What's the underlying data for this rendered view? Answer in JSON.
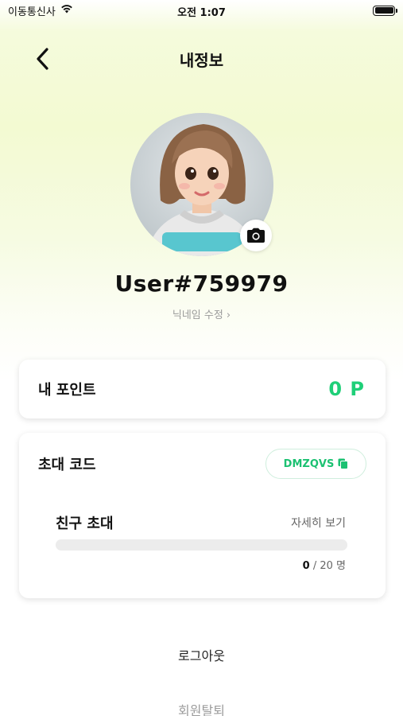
{
  "status_bar": {
    "carrier": "이동통신사",
    "time": "오전 1:07",
    "wifi_icon": "wifi-icon",
    "battery_icon": "battery-icon"
  },
  "nav": {
    "title": "내정보",
    "back_icon": "chevron-left-icon"
  },
  "profile": {
    "username": "User#759979",
    "nickname_edit": "닉네임 수정 ›",
    "camera_icon": "camera-icon"
  },
  "points": {
    "label": "내 포인트",
    "value": "0 P"
  },
  "invite": {
    "label": "초대 코드",
    "code": "DMZQVS",
    "copy_icon": "copy-icon",
    "friend_title": "친구 초대",
    "detail_link": "자세히 보기",
    "current": "0",
    "total": " / 20 명",
    "progress": 0
  },
  "actions": {
    "logout": "로그아웃",
    "withdraw": "회원탈퇴"
  },
  "colors": {
    "accent": "#1fcf78",
    "background_tint": "#f3fad2"
  }
}
